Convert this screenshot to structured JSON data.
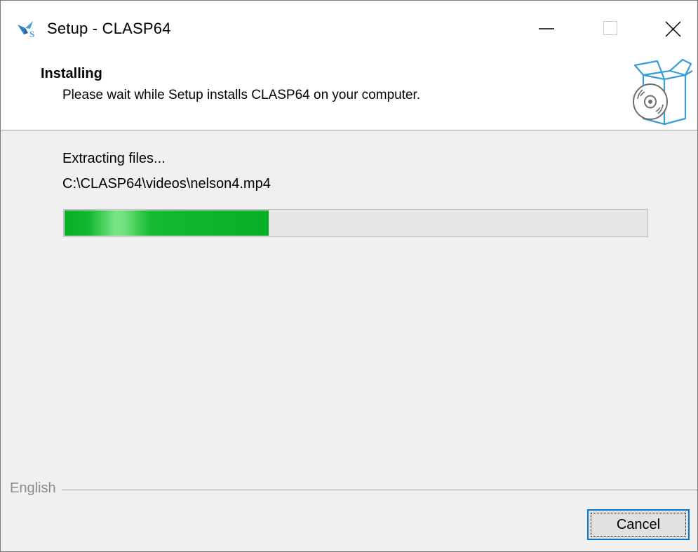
{
  "window": {
    "title": "Setup - CLASP64",
    "controls": {
      "minimize": "minimize-icon",
      "maximize": "maximize-icon",
      "close": "close-icon"
    }
  },
  "header": {
    "title": "Installing",
    "subtitle": "Please wait while Setup installs CLASP64 on your computer.",
    "icon": "package-disc-icon"
  },
  "progress": {
    "status": "Extracting files...",
    "current_file": "C:\\CLASP64\\videos\\nelson4.mp4",
    "fraction": 0.35
  },
  "footer": {
    "language": "English",
    "cancel_label": "Cancel"
  },
  "colors": {
    "progress_green": "#06b025",
    "focus_blue": "#0078d7",
    "icon_blue": "#3a9bd9"
  }
}
